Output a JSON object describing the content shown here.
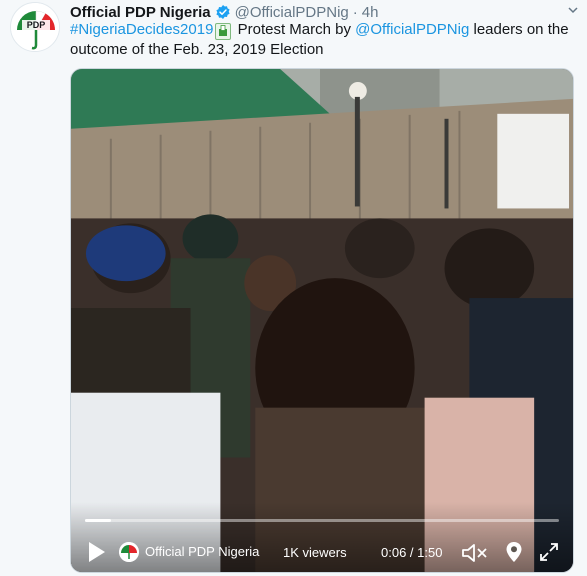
{
  "tweet": {
    "display_name": "Official PDP Nigeria",
    "handle": "@OfficialPDPNig",
    "separator": "·",
    "time": "4h",
    "hashtag": "#NigeriaDecides2019",
    "text_part1": " Protest March by ",
    "mention": "@OfficialPDPNig",
    "text_part2": " leaders on the outcome of the Feb. 23, 2019 Election",
    "avatar_logo_text": "PDP",
    "icons": {
      "verified": "verified-badge-icon",
      "caret": "chevron-down-icon",
      "emoji": "ballot-box-emoji-icon"
    },
    "colors": {
      "link": "#1b95e0",
      "verified": "#1da1f2",
      "pdp_green": "#1f8a3a",
      "pdp_red": "#e3262b"
    }
  },
  "video": {
    "channel_name": "Official PDP Nigeria",
    "viewers": "1K viewers",
    "current_time": "0:06",
    "duration": "1:50",
    "timecode": "0:06 / 1:50",
    "progress": 0.055,
    "icons": {
      "play": "play-icon",
      "mute": "volume-muted-icon",
      "location": "location-pin-icon",
      "fullscreen": "fullscreen-icon"
    }
  }
}
